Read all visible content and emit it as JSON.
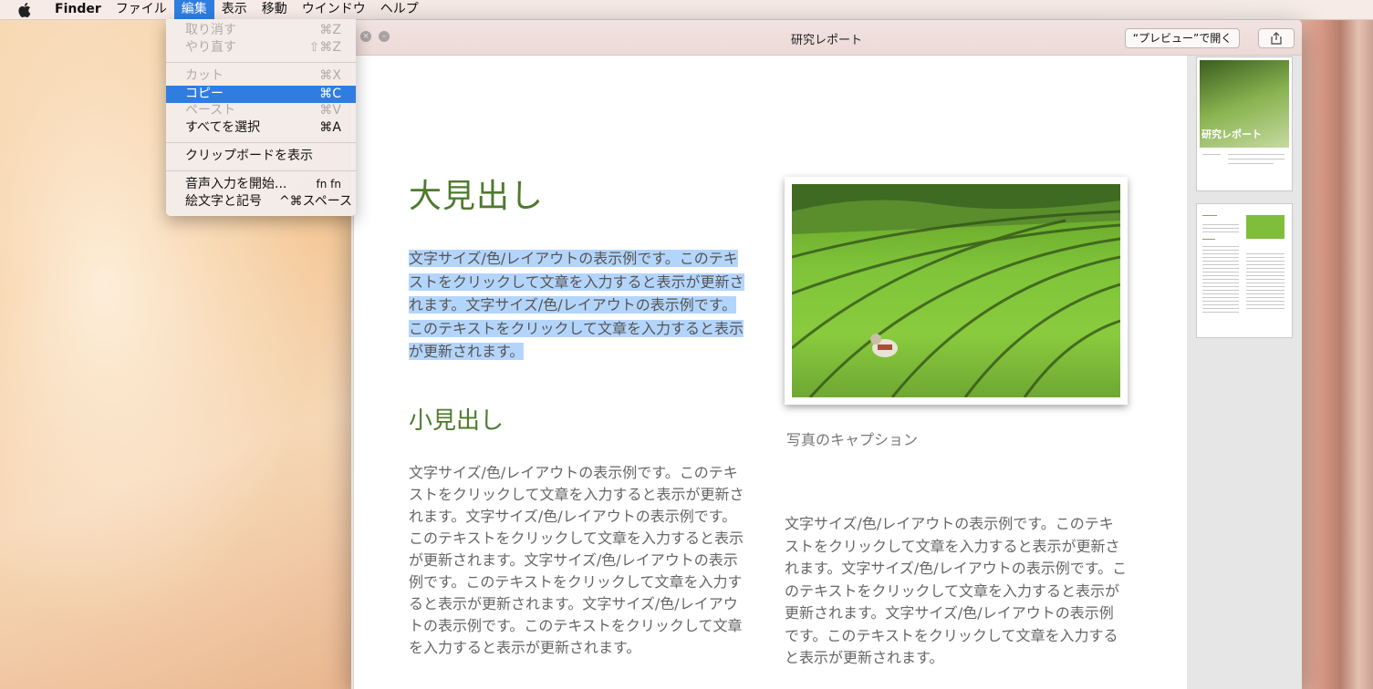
{
  "menubar": {
    "app_name": "Finder",
    "items": [
      "ファイル",
      "編集",
      "表示",
      "移動",
      "ウインドウ",
      "ヘルプ"
    ]
  },
  "edit_menu": {
    "undo": {
      "label": "取り消す",
      "shortcut": "⌘Z"
    },
    "redo": {
      "label": "やり直す",
      "shortcut": "⇧⌘Z"
    },
    "cut": {
      "label": "カット",
      "shortcut": "⌘X"
    },
    "copy": {
      "label": "コピー",
      "shortcut": "⌘C"
    },
    "paste": {
      "label": "ペースト",
      "shortcut": "⌘V"
    },
    "select_all": {
      "label": "すべてを選択",
      "shortcut": "⌘A"
    },
    "show_clipboard": {
      "label": "クリップボードを表示"
    },
    "dictation": {
      "label": "音声入力を開始...",
      "shortcut": "fn fn"
    },
    "emoji": {
      "label": "絵文字と記号",
      "shortcut": "^⌘スペース"
    }
  },
  "window": {
    "title": "研究レポート",
    "preview_button": "“プレビュー”で開く"
  },
  "document": {
    "heading": "大見出し",
    "selected_paragraph": "文字サイズ/色/レイアウトの表示例です。このテキストをクリックして文章を入力すると表示が更新されます。文字サイズ/色/レイアウトの表示例です。このテキストをクリックして文章を入力すると表示が更新されます。",
    "subheading": "小見出し",
    "left_body": "文字サイズ/色/レイアウトの表示例です。このテキストをクリックして文章を入力すると表示が更新されます。文字サイズ/色/レイアウトの表示例です。このテキストをクリックして文章を入力すると表示が更新されます。文字サイズ/色/レイアウトの表示例です。このテキストをクリックして文章を入力すると表示が更新されます。文字サイズ/色/レイアウトの表示例です。このテキストをクリックして文章を入力すると表示が更新されます。",
    "photo_caption": "写真のキャプション",
    "right_body": "文字サイズ/色/レイアウトの表示例です。このテキストをクリックして文章を入力すると表示が更新されます。文字サイズ/色/レイアウトの表示例です。このテキストをクリックして文章を入力すると表示が更新されます。文字サイズ/色/レイアウトの表示例です。このテキストをクリックして文章を入力すると表示が更新されます。"
  },
  "thumbnails": {
    "page1_title": "研究レポート"
  },
  "icons": {
    "apple": "apple-icon",
    "close": "close-icon",
    "minimize": "minimize-icon",
    "share": "share-icon"
  },
  "colors": {
    "accent": "#2f7de1",
    "heading_green": "#4f7a2e",
    "selection": "#b4d5fb"
  }
}
